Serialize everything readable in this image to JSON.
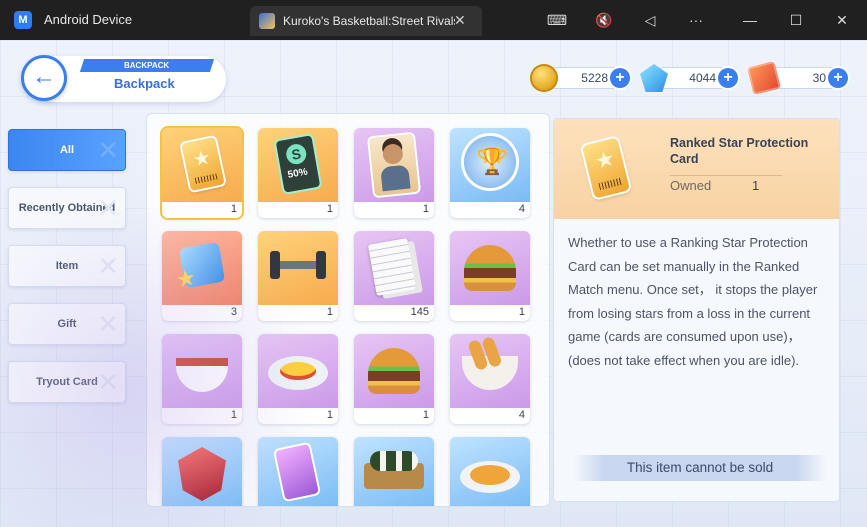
{
  "window": {
    "app_name": "Android Device",
    "tab_title": "Kuroko's Basketball:Street Rivals",
    "tab_close": "✕",
    "controls": [
      "⌨",
      "🔇",
      "◁",
      "···",
      "—",
      "☐",
      "✕"
    ]
  },
  "header": {
    "tag": "BACKPACK",
    "title": "Backpack",
    "back": "←"
  },
  "currencies": [
    {
      "icon": "gold-coin-icon",
      "value": "5228"
    },
    {
      "icon": "diamond-icon",
      "value": "4044"
    },
    {
      "icon": "ticket-icon",
      "value": "30"
    }
  ],
  "plus": "+",
  "sidebar": {
    "items": [
      {
        "label": "All",
        "active": true
      },
      {
        "label": "Recently Obtained",
        "active": false
      },
      {
        "label": "Item",
        "active": false
      },
      {
        "label": "Gift",
        "active": false
      },
      {
        "label": "Tryout Card",
        "active": false
      }
    ]
  },
  "grid": {
    "items": [
      {
        "icon": "star-protection-card-icon",
        "qty": "1",
        "selected": true
      },
      {
        "icon": "vip-discount-card-icon",
        "qty": "1"
      },
      {
        "icon": "player-card-icon",
        "qty": "1"
      },
      {
        "icon": "trophy-icon",
        "qty": "4"
      },
      {
        "icon": "puzzle-star-icon",
        "qty": "3"
      },
      {
        "icon": "dumbbell-icon",
        "qty": "1"
      },
      {
        "icon": "documents-icon",
        "qty": "145"
      },
      {
        "icon": "burger-icon",
        "qty": "1"
      },
      {
        "icon": "soup-bowl-icon",
        "qty": "1"
      },
      {
        "icon": "omelet-rice-icon",
        "qty": "1"
      },
      {
        "icon": "cheeseburger-icon",
        "qty": "1"
      },
      {
        "icon": "tempura-bowl-icon",
        "qty": "4"
      },
      {
        "icon": "red-shield-icon",
        "qty": ""
      },
      {
        "icon": "purple-card-icon",
        "qty": ""
      },
      {
        "icon": "sushi-roll-icon",
        "qty": ""
      },
      {
        "icon": "curry-rice-icon",
        "qty": ""
      }
    ]
  },
  "detail": {
    "name": "Ranked Star Protection Card",
    "owned_label": "Owned",
    "owned_value": "1",
    "description": "Whether to use a Ranking Star Protection Card can be set manually in the Ranked Match menu. Once set， it stops the player from losing stars from a loss in the current game (cards are consumed upon use)， (does not take effect when you are idle).",
    "sold_notice": "This item cannot be sold"
  }
}
